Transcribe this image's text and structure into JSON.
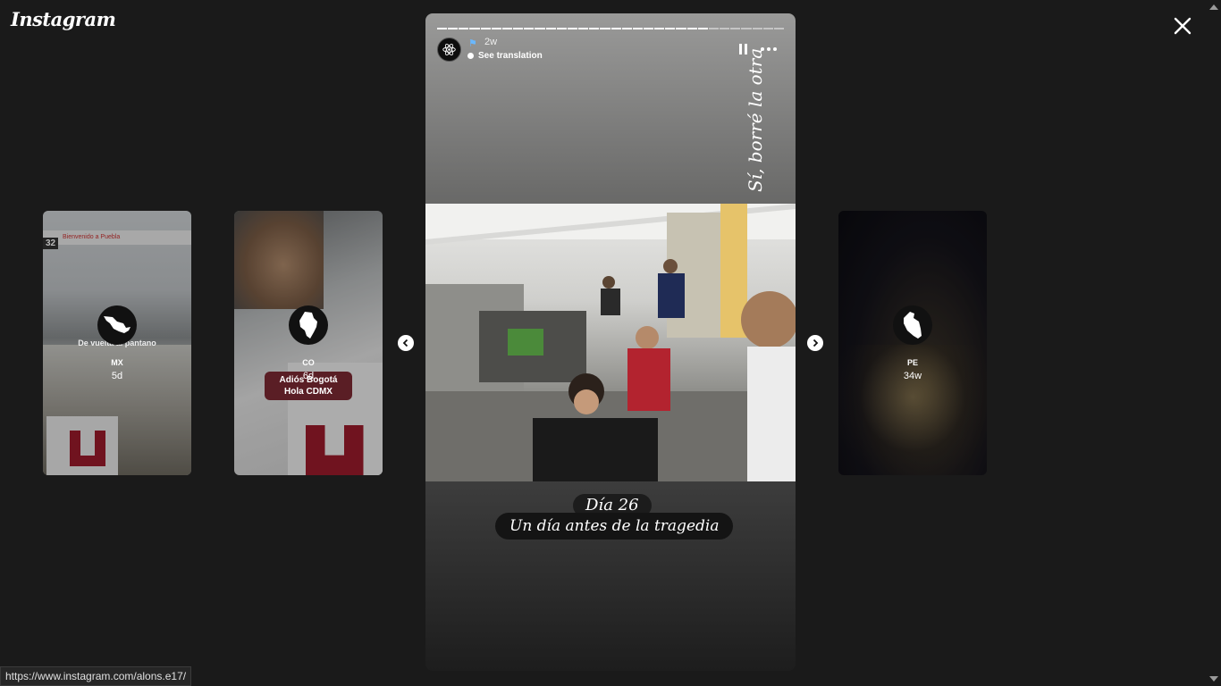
{
  "header": {
    "logo_text": "Instagram"
  },
  "previews": [
    {
      "username": "MX",
      "time": "5d",
      "caption": "De vuelta al pantano",
      "sign_text": "Bienvenido a Puebla",
      "sign_number": "32"
    },
    {
      "username": "CO",
      "time": "6d",
      "caption_line1": "Adiós Bogotá",
      "caption_line2": "Hola CDMX"
    },
    {
      "username": "PE",
      "time": "34w"
    }
  ],
  "story": {
    "time": "2w",
    "translation_label": "See translation",
    "side_text": "Sí, borré la otra",
    "caption_day": "Día 26",
    "caption_text": "Un día antes de la tragedia",
    "progress_segments": 32,
    "progress_done": 25
  },
  "status_bar": {
    "url": "https://www.instagram.com/alons.e17/"
  },
  "colors": {
    "background": "#1a1a1a",
    "pill": "#5a1e25"
  }
}
